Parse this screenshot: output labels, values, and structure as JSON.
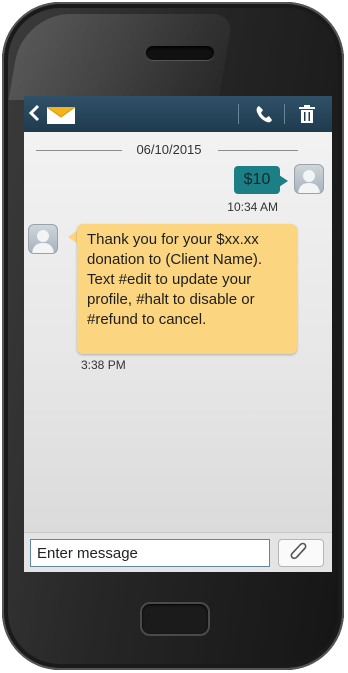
{
  "device": {
    "name": "smartphone"
  },
  "topbar": {
    "back_icon": "chevron-left-icon",
    "mail_icon": "envelope-icon",
    "call_icon": "phone-icon",
    "delete_icon": "trash-icon"
  },
  "conversation": {
    "date": "06/10/2015",
    "messages": [
      {
        "direction": "outgoing",
        "text": "$10",
        "time": "10:34 AM"
      },
      {
        "direction": "incoming",
        "text": "Thank you for your $xx.xx donation to (Client Name). Text #edit to update your profile, #halt to disable or #refund to cancel.",
        "time": "3:38 PM"
      }
    ]
  },
  "compose": {
    "placeholder": "Enter message",
    "attach_icon": "paperclip-icon"
  },
  "colors": {
    "topbar": "#1f3b4e",
    "outgoing_bubble": "#1d7f86",
    "incoming_bubble": "#fbd57f",
    "input_border": "#5f86a6"
  }
}
